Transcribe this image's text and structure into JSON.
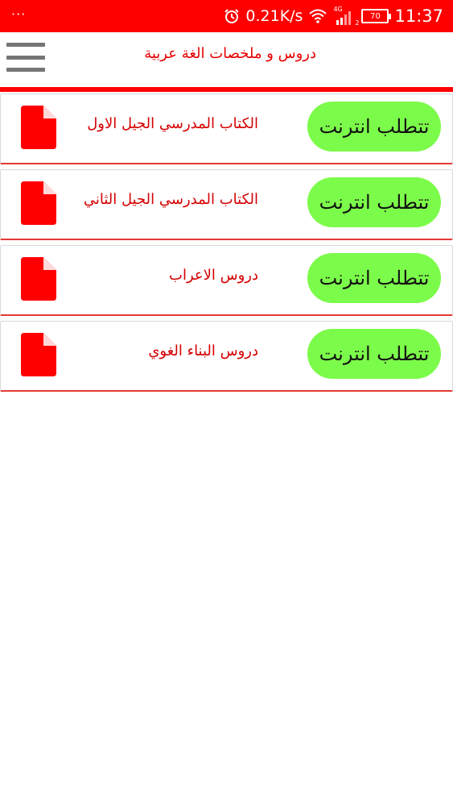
{
  "statusbar": {
    "left_text": "···",
    "net_speed": "0.21K/s",
    "network_label": "4G",
    "sim_label": "2",
    "battery": "70",
    "time": "11:37",
    "icons": [
      "alarm-icon",
      "wifi-icon",
      "signal-icon",
      "battery-icon"
    ]
  },
  "appbar": {
    "title": "دروس و ملخصات الغة عربية",
    "menu_icon": "hamburger-menu-icon"
  },
  "items": [
    {
      "title": "الكتاب المدرسي الجيل الاول",
      "button": "تتطلب انترنت",
      "icon": "pdf-file-icon"
    },
    {
      "title": "الكتاب المدرسي الجيل الثاني",
      "button": "تتطلب انترنت",
      "icon": "pdf-file-icon"
    },
    {
      "title": "دروس الاعراب",
      "button": "تتطلب انترنت",
      "icon": "pdf-file-icon"
    },
    {
      "title": "دروس البناء الغوي",
      "button": "تتطلب انترنت",
      "icon": "pdf-file-icon"
    }
  ],
  "colors": {
    "primary": "#ff0000",
    "title_text": "#e60000",
    "button_bg": "#7cfc4a",
    "menu_icon": "#757575"
  }
}
